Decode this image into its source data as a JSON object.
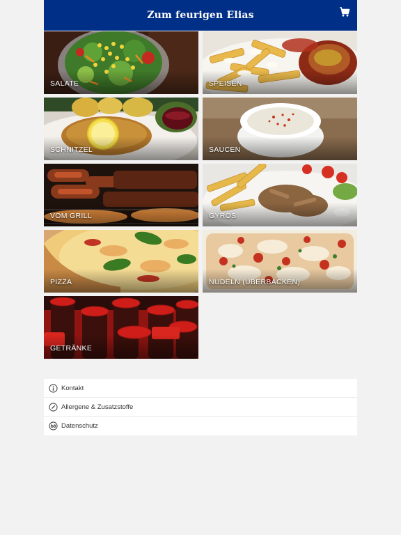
{
  "header": {
    "title": "Zum feurigen Elias",
    "cart_icon": "shopping-cart-icon",
    "background": "#002f87"
  },
  "categories": [
    {
      "label": "SALATE"
    },
    {
      "label": "SPEISEN"
    },
    {
      "label": "SCHNITZEL"
    },
    {
      "label": "SAUCEN"
    },
    {
      "label": "VOM GRILL"
    },
    {
      "label": "GYROS"
    },
    {
      "label": "PIZZA"
    },
    {
      "label": "NUDELN (ÜBERBACKEN)"
    },
    {
      "label": "GETRÄNKE"
    }
  ],
  "links": [
    {
      "label": "Kontakt",
      "icon": "info-icon"
    },
    {
      "label": "Allergene & Zusatzstoffe",
      "icon": "pencil-icon"
    },
    {
      "label": "Datenschutz",
      "icon": "privacy-icon"
    }
  ]
}
